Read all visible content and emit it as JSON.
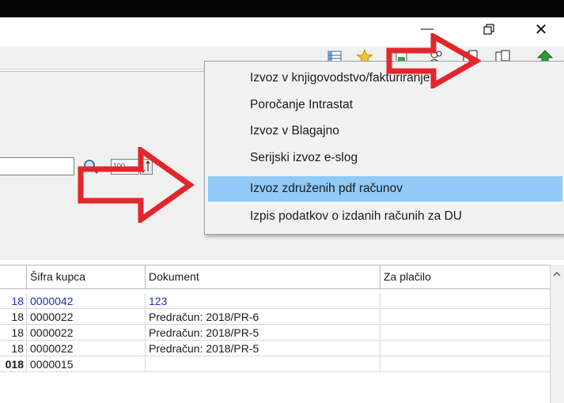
{
  "window": {
    "minimize_glyph": "—",
    "restore_icon": "restore-icon",
    "close_glyph": "✕"
  },
  "toolbar": {
    "icons": [
      "grid-icon",
      "star-icon",
      "document-icon",
      "users-icon",
      "copy-icon",
      "paste-icon",
      "export-icon"
    ]
  },
  "search": {
    "value": "",
    "rows_value": "100"
  },
  "menu": {
    "items": [
      {
        "label": "Izvoz v knjigovodstvo/fakturiranje",
        "highlighted": false
      },
      {
        "label": "Poročanje Intrastat",
        "highlighted": false
      },
      {
        "label": "Izvoz v Blagajno",
        "highlighted": false
      },
      {
        "label": "Serijski izvoz e-slog",
        "highlighted": false
      },
      {
        "label": "Izvoz združenih pdf računov",
        "highlighted": true
      },
      {
        "label": "Izpis podatkov o izdanih računih za DU",
        "highlighted": false
      }
    ]
  },
  "table": {
    "columns": [
      "",
      "Šifra kupca",
      "Dokument",
      "Za plačilo"
    ],
    "rows": [
      {
        "c0": "18",
        "c1": "0000042",
        "c2": "123",
        "c3": "",
        "style": "blue"
      },
      {
        "c0": "18",
        "c1": "0000022",
        "c2": "Predračun: 2018/PR-6",
        "c3": "",
        "style": "normal"
      },
      {
        "c0": "18",
        "c1": "0000022",
        "c2": "Predračun: 2018/PR-5",
        "c3": "",
        "style": "normal"
      },
      {
        "c0": "18",
        "c1": "0000022",
        "c2": "Predračun: 2018/PR-5",
        "c3": "",
        "style": "normal"
      },
      {
        "c0": "018",
        "c1": "0000015",
        "c2": "",
        "c3": "",
        "style": "bold"
      }
    ]
  },
  "annotations": {
    "arrow_color": "#e3262c"
  }
}
